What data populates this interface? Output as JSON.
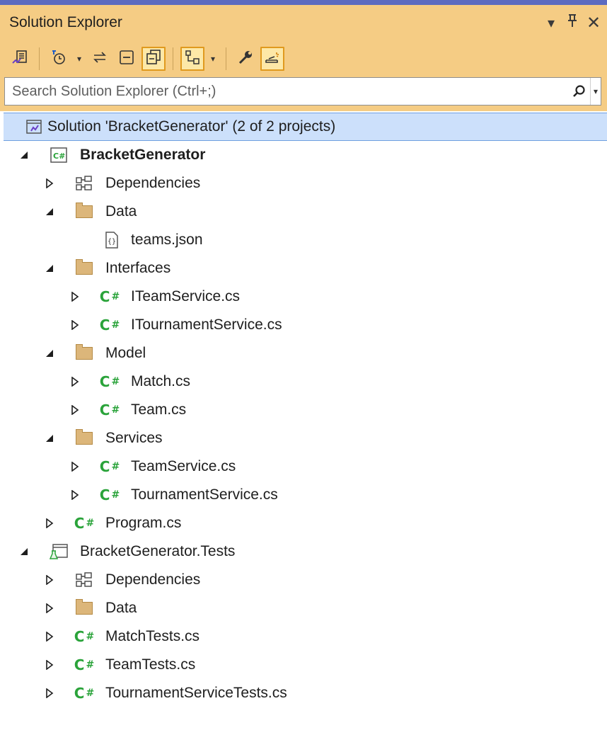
{
  "window": {
    "title": "Solution Explorer",
    "controls": {
      "dropdown": "▾",
      "pin": "Ⅱ",
      "close": "✕"
    }
  },
  "toolbar": {
    "buttons": [
      {
        "name": "switch-views-icon",
        "active": false
      },
      {
        "name": "pending-changes-filter-icon",
        "active": false
      },
      {
        "name": "sync-with-active-document-icon",
        "active": false
      },
      {
        "name": "collapse-all-icon",
        "active": false
      },
      {
        "name": "show-all-files-icon",
        "active": true
      },
      {
        "name": "view-class-diagram-icon",
        "active": true
      },
      {
        "name": "properties-icon",
        "active": false
      },
      {
        "name": "preview-selected-items-icon",
        "active": true
      }
    ]
  },
  "search": {
    "placeholder": "Search Solution Explorer (Ctrl+;)"
  },
  "tree": {
    "solution": "Solution 'BracketGenerator' (2 of 2 projects)",
    "project1": {
      "name": "BracketGenerator",
      "dependencies": "Dependencies",
      "data_folder": "Data",
      "teams_json": "teams.json",
      "interfaces_folder": "Interfaces",
      "iteamservice": "ITeamService.cs",
      "itournamentservice": "ITournamentService.cs",
      "model_folder": "Model",
      "match": "Match.cs",
      "team": "Team.cs",
      "services_folder": "Services",
      "teamservice": "TeamService.cs",
      "tournamentservice": "TournamentService.cs",
      "program": "Program.cs"
    },
    "project2": {
      "name": "BracketGenerator.Tests",
      "dependencies": "Dependencies",
      "data_folder": "Data",
      "matchtests": "MatchTests.cs",
      "teamtests": "TeamTests.cs",
      "tournamentservicetests": "TournamentServiceTests.cs"
    },
    "csharp_glyph": "C#"
  },
  "colors": {
    "title_bar": "#f5cc84",
    "selection": "#cce0fb",
    "csharp": "#2aa33a",
    "folder": "#dcb67a"
  }
}
